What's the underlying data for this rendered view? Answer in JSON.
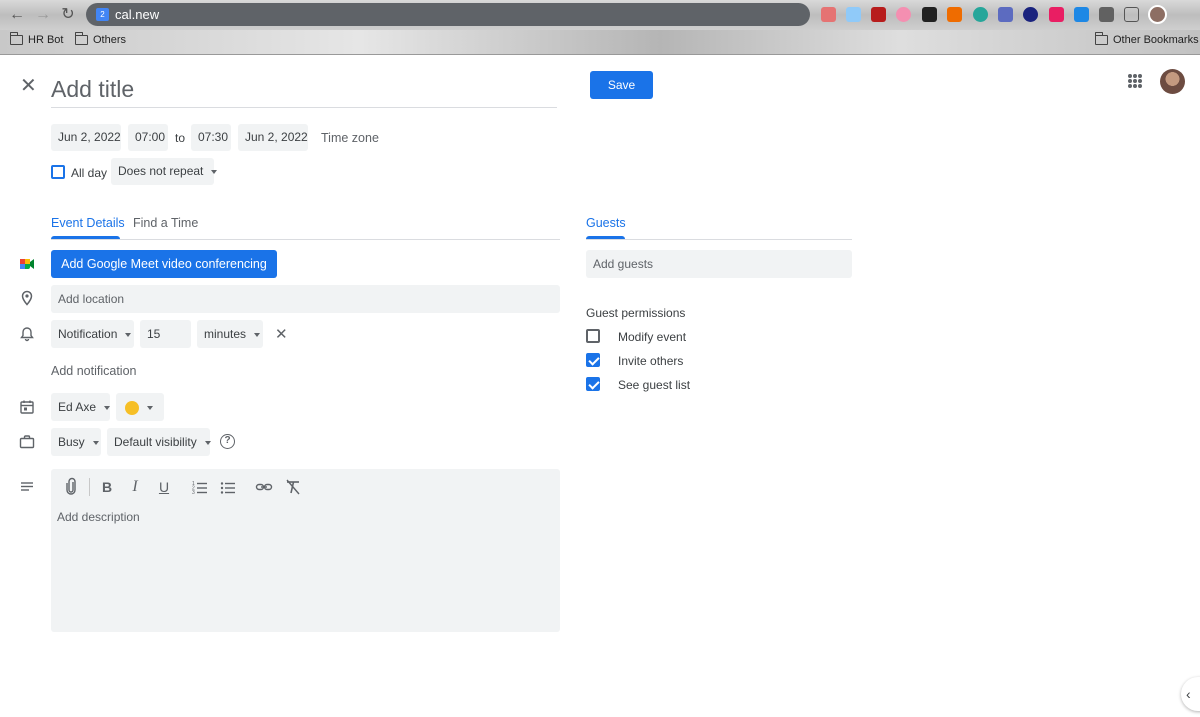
{
  "browser": {
    "url": "cal.new",
    "bookmarks": [
      "HR Bot",
      "Others"
    ],
    "other_bookmarks": "Other Bookmarks"
  },
  "header": {
    "title_placeholder": "Add title",
    "save_label": "Save"
  },
  "datetime": {
    "start_date": "Jun 2, 2022",
    "start_time": "07:00",
    "to_label": "to",
    "end_time": "07:30",
    "end_date": "Jun 2, 2022",
    "timezone_label": "Time zone",
    "all_day_label": "All day",
    "repeat_value": "Does not repeat"
  },
  "tabs": {
    "event_details": "Event Details",
    "find_time": "Find a Time",
    "guests": "Guests"
  },
  "details": {
    "meet_button": "Add Google Meet video conferencing",
    "location_placeholder": "Add location",
    "notification_type": "Notification",
    "notification_value": "15",
    "notification_unit": "minutes",
    "add_notification": "Add notification",
    "calendar_owner": "Ed Axe",
    "event_color": "#f6bf26",
    "busy_status": "Busy",
    "visibility": "Default visibility",
    "description_placeholder": "Add description"
  },
  "guests": {
    "add_placeholder": "Add guests",
    "permissions_title": "Guest permissions",
    "permissions": [
      {
        "label": "Modify event",
        "checked": false
      },
      {
        "label": "Invite others",
        "checked": true
      },
      {
        "label": "See guest list",
        "checked": true
      }
    ]
  },
  "colors": {
    "accent": "#1a73e8",
    "field_bg": "#f1f3f4"
  }
}
